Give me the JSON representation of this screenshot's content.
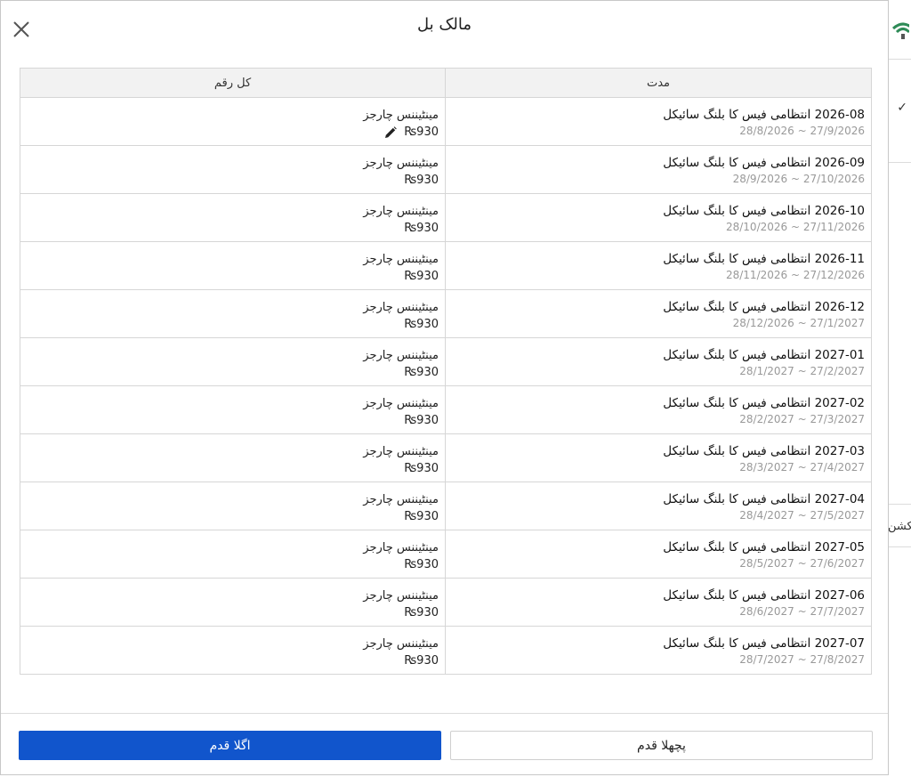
{
  "modal": {
    "title": "مالک بل",
    "close_label": "close"
  },
  "table": {
    "headers": {
      "period": "مدت",
      "amount": "کل رقم"
    },
    "rows": [
      {
        "title": "2026-08 انتظامی فیس کا بلنگ سائیکل",
        "range": "28/8/2026 ~ 27/9/2026",
        "label": "مینٹیننس چارجز",
        "amount": "₨930",
        "editable": true
      },
      {
        "title": "2026-09 انتظامی فیس کا بلنگ سائیکل",
        "range": "28/9/2026 ~ 27/10/2026",
        "label": "مینٹیننس چارجز",
        "amount": "₨930"
      },
      {
        "title": "2026-10 انتظامی فیس کا بلنگ سائیکل",
        "range": "28/10/2026 ~ 27/11/2026",
        "label": "مینٹیننس چارجز",
        "amount": "₨930"
      },
      {
        "title": "2026-11 انتظامی فیس کا بلنگ سائیکل",
        "range": "28/11/2026 ~ 27/12/2026",
        "label": "مینٹیننس چارجز",
        "amount": "₨930"
      },
      {
        "title": "2026-12 انتظامی فیس کا بلنگ سائیکل",
        "range": "28/12/2026 ~ 27/1/2027",
        "label": "مینٹیننس چارجز",
        "amount": "₨930"
      },
      {
        "title": "2027-01 انتظامی فیس کا بلنگ سائیکل",
        "range": "28/1/2027 ~ 27/2/2027",
        "label": "مینٹیننس چارجز",
        "amount": "₨930"
      },
      {
        "title": "2027-02 انتظامی فیس کا بلنگ سائیکل",
        "range": "28/2/2027 ~ 27/3/2027",
        "label": "مینٹیننس چارجز",
        "amount": "₨930"
      },
      {
        "title": "2027-03 انتظامی فیس کا بلنگ سائیکل",
        "range": "28/3/2027 ~ 27/4/2027",
        "label": "مینٹیننس چارجز",
        "amount": "₨930"
      },
      {
        "title": "2027-04 انتظامی فیس کا بلنگ سائیکل",
        "range": "28/4/2027 ~ 27/5/2027",
        "label": "مینٹیننس چارجز",
        "amount": "₨930"
      },
      {
        "title": "2027-05 انتظامی فیس کا بلنگ سائیکل",
        "range": "28/5/2027 ~ 27/6/2027",
        "label": "مینٹیننس چارجز",
        "amount": "₨930"
      },
      {
        "title": "2027-06 انتظامی فیس کا بلنگ سائیکل",
        "range": "28/6/2027 ~ 27/7/2027",
        "label": "مینٹیننس چارجز",
        "amount": "₨930"
      },
      {
        "title": "2027-07 انتظامی فیس کا بلنگ سائیکل",
        "range": "28/7/2027 ~ 27/8/2027",
        "label": "مینٹیننس چارجز",
        "amount": "₨930"
      }
    ]
  },
  "footer": {
    "next_label": "اگلا قدم",
    "prev_label": "پچھلا قدم"
  },
  "background": {
    "partial_text": "سیکشن",
    "check_glyph": "✓"
  },
  "colors": {
    "primary": "#1155cc",
    "header_bg": "#f2f2f2",
    "muted_text": "#999999",
    "wifi_accent": "#2e8b57"
  },
  "icons": {
    "close": "close-icon",
    "edit": "pencil-icon",
    "wifi": "wifi-icon",
    "check": "check-icon"
  }
}
